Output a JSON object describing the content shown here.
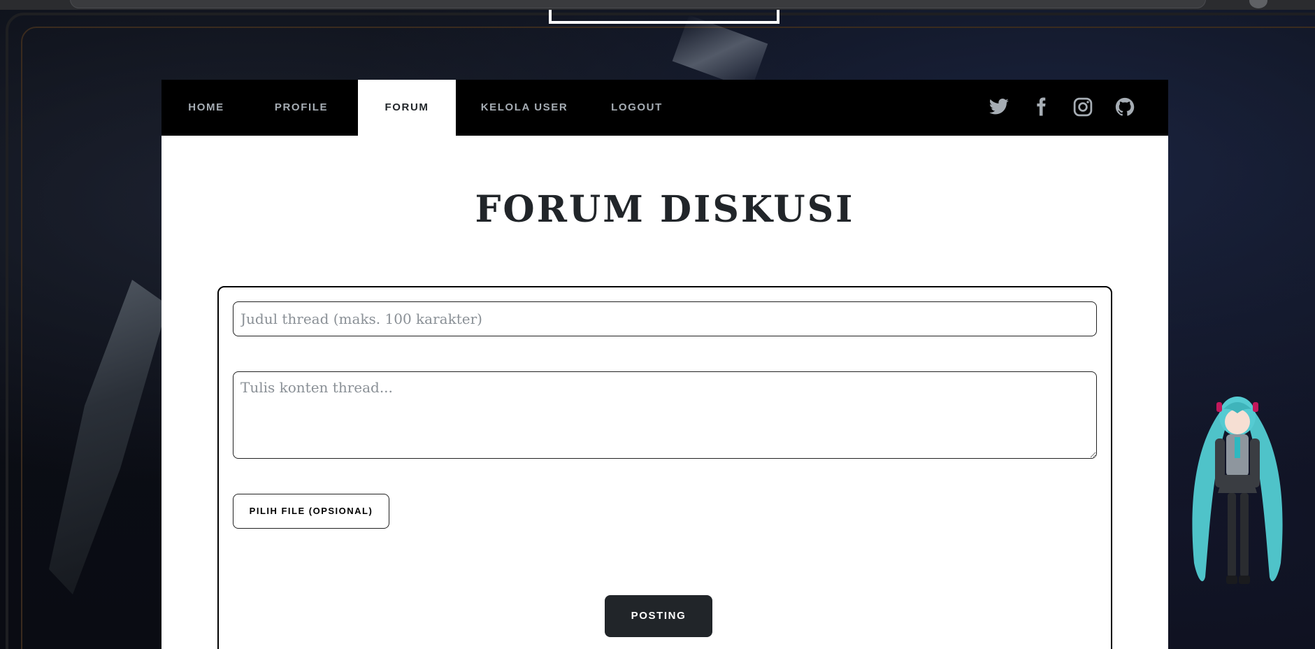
{
  "nav": {
    "items": [
      {
        "label": "HOME"
      },
      {
        "label": "PROFILE"
      },
      {
        "label": "FORUM",
        "active": true
      },
      {
        "label": "KELOLA USER"
      },
      {
        "label": "LOGOUT"
      }
    ],
    "social_icons": [
      "twitter-icon",
      "facebook-icon",
      "instagram-icon",
      "github-icon"
    ]
  },
  "page": {
    "title": "FORUM DISKUSI"
  },
  "form": {
    "title_placeholder": "Judul thread (maks. 100 karakter)",
    "title_value": "",
    "content_placeholder": "Tulis konten thread...",
    "content_value": "",
    "file_button_label": "PILIH FILE (OPSIONAL)",
    "submit_label": "POSTING"
  },
  "colors": {
    "navbar_bg": "#000000",
    "nav_text": "#a6adb4",
    "active_text": "#212529",
    "title_color": "#212529",
    "primary_button": "#212529"
  }
}
